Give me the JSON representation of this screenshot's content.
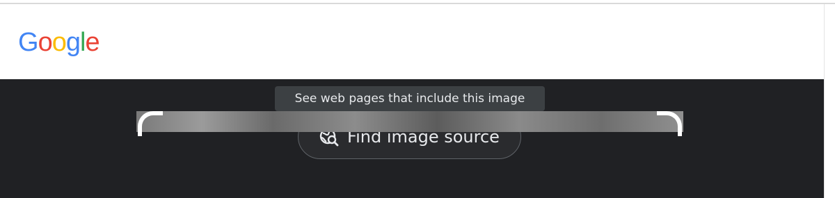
{
  "header": {
    "logo_text": "Google",
    "logo_letters": [
      {
        "char": "G",
        "color": "#4285F4"
      },
      {
        "char": "o",
        "color": "#EA4335"
      },
      {
        "char": "o",
        "color": "#FBBC05"
      },
      {
        "char": "g",
        "color": "#4285F4"
      },
      {
        "char": "l",
        "color": "#34A853"
      },
      {
        "char": "e",
        "color": "#EA4335"
      }
    ]
  },
  "lens": {
    "find_source_button": {
      "label": "Find image source",
      "icon": "globe-search-icon"
    },
    "tooltip": "See web pages that include this image"
  },
  "colors": {
    "stage_background": "#202124",
    "button_text": "#e8eaed",
    "tooltip_background": "#3c4043"
  }
}
